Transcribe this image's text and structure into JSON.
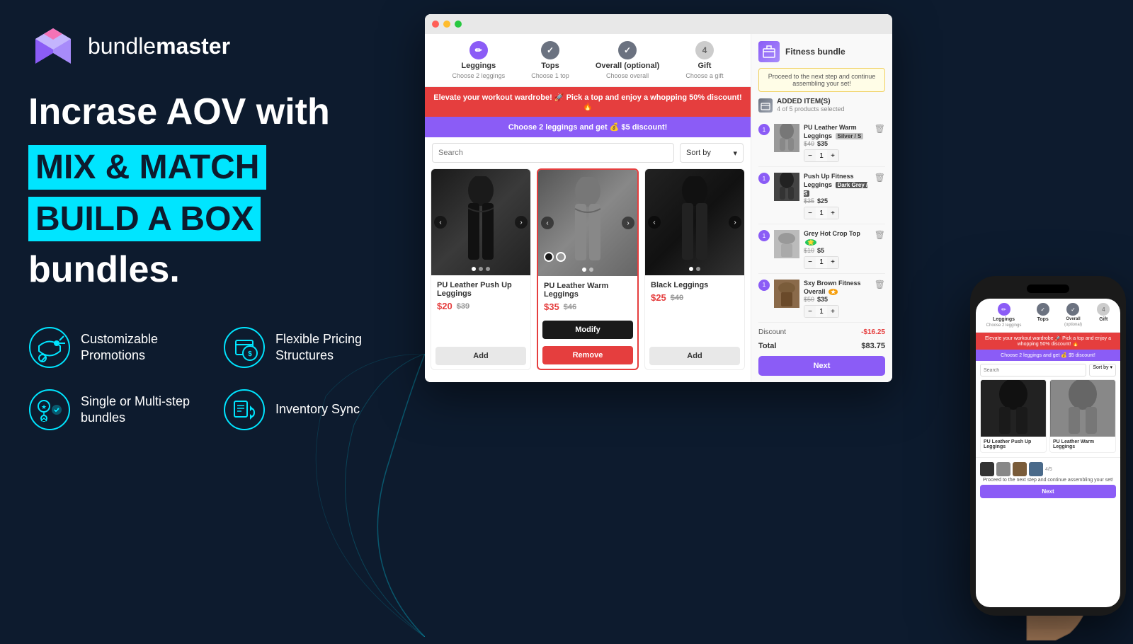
{
  "app": {
    "name": "bundlemaster",
    "logo_text_light": "bundle",
    "logo_text_bold": "master"
  },
  "left": {
    "headline_line1": "Incrase AOV with",
    "headline_highlight1": "MIX & MATCH",
    "headline_highlight2": "BUILD A BOX",
    "headline_line3": "bundles.",
    "features": [
      {
        "id": "customizable-promotions",
        "label": "Customizable Promotions",
        "icon": "megaphone-icon"
      },
      {
        "id": "flexible-pricing",
        "label": "Flexible Pricing Structures",
        "icon": "pricing-icon"
      },
      {
        "id": "single-multi-step",
        "label": "Single or Multi-step bundles",
        "icon": "bundles-icon"
      },
      {
        "id": "inventory-sync",
        "label": "Inventory Sync",
        "icon": "sync-icon"
      }
    ]
  },
  "steps": [
    {
      "label": "Leggings",
      "sub": "Choose 2 leggings",
      "state": "active",
      "num": "1"
    },
    {
      "label": "Tops",
      "sub": "Choose 1 top",
      "state": "done",
      "num": "2"
    },
    {
      "label": "Overall (optional)",
      "sub": "Choose overall",
      "state": "done",
      "num": "3"
    },
    {
      "label": "Gift",
      "sub": "Choose a gift",
      "state": "pending",
      "num": "4"
    }
  ],
  "banners": {
    "red": "Elevate your workout wardrobe! 🚀 Pick a top and enjoy a whopping 50% discount! 🔥",
    "purple": "Choose 2 leggings and get 💰 $5 discount!"
  },
  "search": {
    "placeholder": "Search",
    "sort_label": "Sort by"
  },
  "products": [
    {
      "name": "PU Leather Push Up Leggings",
      "price": "$20",
      "original_price": "$39",
      "img_class": "product-img-legging1",
      "state": "add"
    },
    {
      "name": "PU Leather Warm Leggings",
      "price": "$35",
      "original_price": "$46",
      "img_class": "product-img-legging2",
      "state": "selected"
    },
    {
      "name": "Black Leggings",
      "price": "$25",
      "original_price": "$40",
      "img_class": "product-img-legging3",
      "state": "add"
    }
  ],
  "sidebar": {
    "bundle_name": "Fitness bundle",
    "proceed_text": "Proceed to the next step and continue assembling your set!",
    "added_title": "ADDED ITEM(S)",
    "added_sub": "4 of 5 products selected",
    "cart_items": [
      {
        "name": "PU Leather Warm Leggings",
        "tag": "Silver / S",
        "price_old": "$40",
        "price_new": "$35",
        "qty": "1",
        "img_class": "grey"
      },
      {
        "name": "Push Up Fitness Leggings",
        "tag": "Dark Grey / S",
        "price_old": "$35",
        "price_new": "$25",
        "qty": "1",
        "img_class": "dark"
      },
      {
        "name": "Grey Hot Crop Top",
        "tag": "",
        "price_old": "$10",
        "price_new": "$5",
        "qty": "1",
        "img_class": "grey"
      },
      {
        "name": "Sxy Brown Fitness Overall",
        "tag": "",
        "price_old": "$50",
        "price_new": "$35",
        "qty": "1",
        "img_class": "brown"
      }
    ],
    "discount_label": "Discount",
    "discount_val": "-$16.25",
    "total_label": "Total",
    "total_val": "$83.75",
    "next_label": "Next"
  },
  "mobile": {
    "banner_red": "Elevate your workout wardrobe 🚀 Pick a top and enjoy a whopping 50% discount! 🔥",
    "banner_purple": "Choose 2 leggings and get 💰 $5 discount!",
    "search_placeholder": "Search",
    "products": [
      {
        "name": "PU Leather Push Up Leggings",
        "img_class": "dark"
      },
      {
        "name": "PU Leather Warm Leggings",
        "img_class": "grey"
      }
    ],
    "count_text": "4/5",
    "proceed_text": "Proceed to the next step and continue assembling your set!",
    "next_label": "Next"
  }
}
